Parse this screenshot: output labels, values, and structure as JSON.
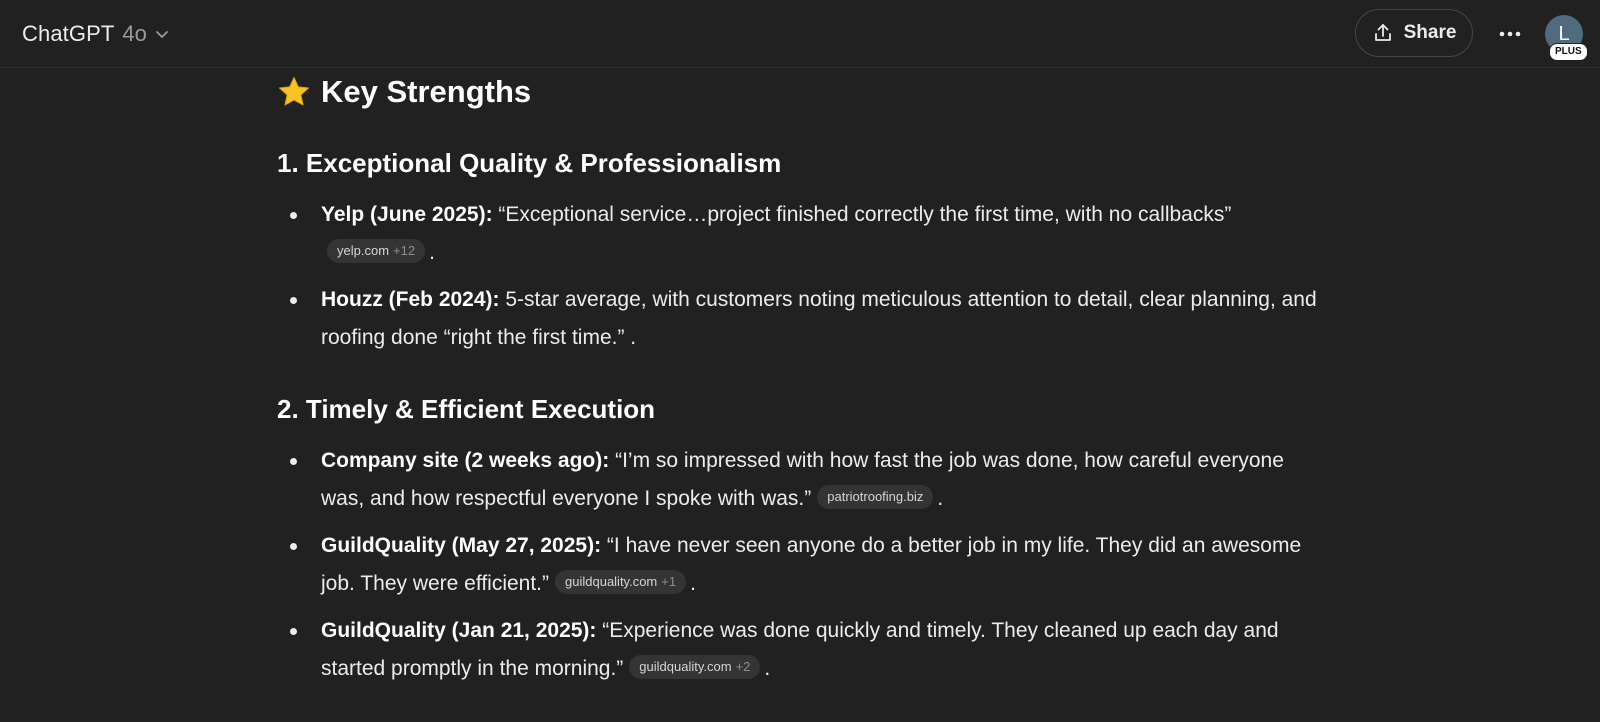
{
  "header": {
    "model_name": "ChatGPT",
    "model_version": "4o",
    "share_label": "Share",
    "avatar_initial": "L",
    "plan_badge": "PLUS"
  },
  "response": {
    "title": "Key Strengths",
    "sections": [
      {
        "heading": "1. Exceptional Quality & Professionalism",
        "items": [
          {
            "source": "Yelp (June 2025):",
            "text": " “Exceptional service…project finished correctly the first time, with no callbacks”",
            "chip": {
              "domain": "yelp.com",
              "more": "+12"
            },
            "tail": "."
          },
          {
            "source": "Houzz (Feb 2024):",
            "text": " 5‑star average, with customers noting meticulous attention to detail, clear planning, and roofing done “right the first time.” .",
            "chip": null,
            "tail": ""
          }
        ]
      },
      {
        "heading": "2. Timely & Efficient Execution",
        "items": [
          {
            "source": "Company site (2 weeks ago):",
            "text": " “I’m so impressed with how fast the job was done, how careful everyone was, and how respectful everyone I spoke with was.”",
            "chip": {
              "domain": "patriotroofing.biz",
              "more": ""
            },
            "tail": "."
          },
          {
            "source": "GuildQuality (May 27, 2025):",
            "text": " “I have never seen anyone do a better job in my life. They did an awesome job. They were efficient.”",
            "chip": {
              "domain": "guildquality.com",
              "more": "+1"
            },
            "tail": "."
          },
          {
            "source": "GuildQuality (Jan 21, 2025):",
            "text": " “Experience was done quickly and timely. They cleaned up each day and started promptly in the morning.”",
            "chip": {
              "domain": "guildquality.com",
              "more": "+2"
            },
            "tail": "."
          }
        ]
      }
    ]
  },
  "colors": {
    "background": "#212121",
    "text": "#ececec",
    "chip_bg": "#343434",
    "avatar_bg": "#4f6b7d"
  },
  "icons": {
    "title_icon": "star-icon",
    "share_icon": "share-upload-icon",
    "more_icon": "more-horizontal-icon",
    "model_chevron": "chevron-down-icon"
  }
}
